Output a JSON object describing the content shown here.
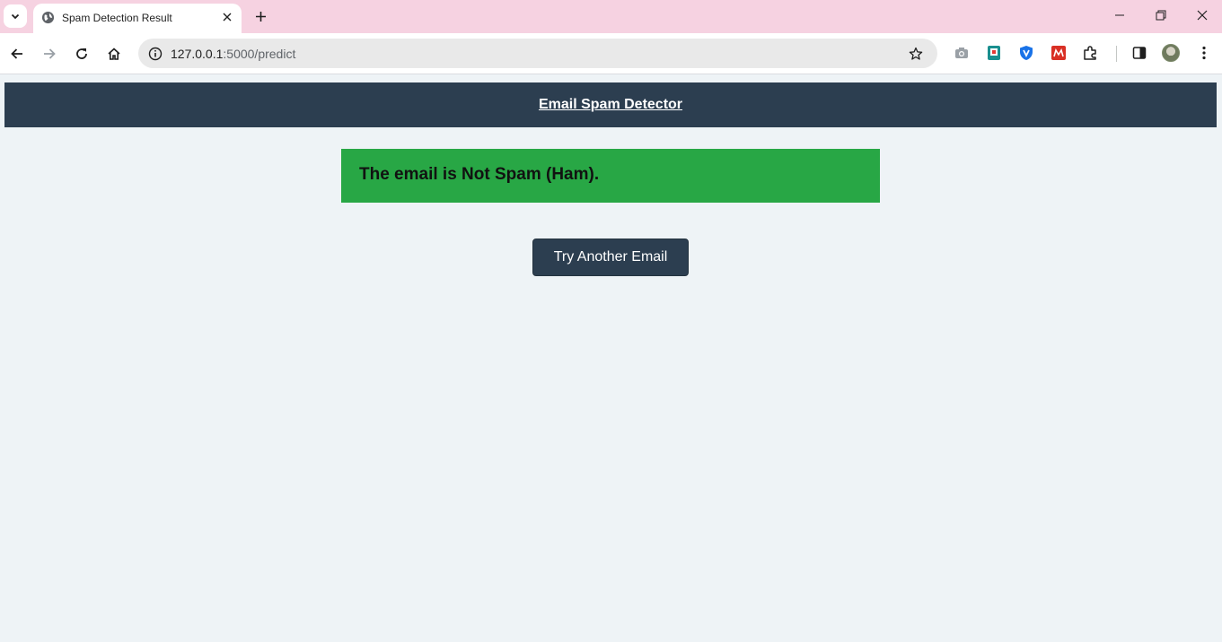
{
  "browser": {
    "tab": {
      "title": "Spam Detection Result",
      "favicon": "globe-icon"
    },
    "address_bar": {
      "host": "127.0.0.1",
      "path": ":5000/predict"
    },
    "icons": {
      "tab_search": "chevron-down-icon",
      "new_tab": "plus-icon",
      "minimize": "minimize-icon",
      "restore": "restore-icon",
      "close": "close-icon",
      "back": "back-arrow-icon",
      "forward": "forward-arrow-icon",
      "reload": "reload-icon",
      "home": "home-icon",
      "site_info": "info-icon",
      "bookmark": "star-icon",
      "camera": "camera-icon",
      "side_panel": "side-panel-icon",
      "menu": "kebab-menu-icon"
    },
    "colors": {
      "tabstrip": "#f6d2e1",
      "toolbar": "#ffffff",
      "omnibox": "#e9e9e9"
    }
  },
  "page": {
    "header": {
      "title": "Email Spam Detector"
    },
    "result": {
      "message": "The email is Not Spam (Ham)."
    },
    "actions": {
      "try_again_label": "Try Another Email"
    },
    "colors": {
      "background": "#eef3f6",
      "header": "#2c3e50",
      "result_ham": "#28a745",
      "button": "#2c3e50"
    }
  }
}
